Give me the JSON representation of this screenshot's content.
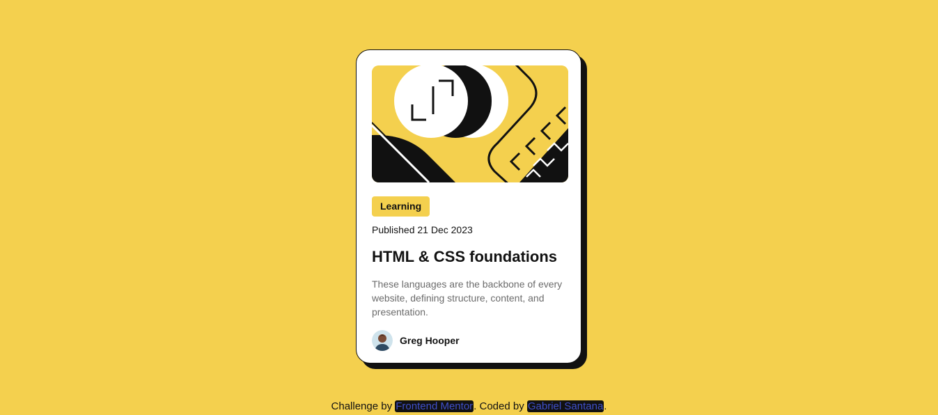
{
  "card": {
    "image_alt": "HTML & CSS foundations illustration",
    "tag": "Learning",
    "published": "Published 21 Dec 2023",
    "title": "HTML & CSS foundations",
    "description": "These languages are the backbone of every website, defining structure, content, and presentation.",
    "author": {
      "name": "Greg Hooper"
    }
  },
  "attribution": {
    "prefix": "Challenge by ",
    "mentor_link": "Frontend Mentor",
    "middle": ". Coded by ",
    "author_link": "Gabriel Santana",
    "suffix": "."
  },
  "colors": {
    "background": "#F4D04E",
    "card": "#FFFFFF",
    "ink": "#111111",
    "muted": "#6B6B6B"
  }
}
